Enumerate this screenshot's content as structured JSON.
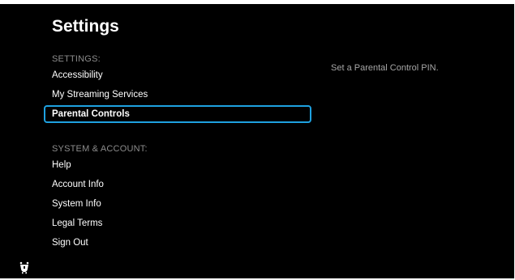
{
  "title": "Settings",
  "sections": [
    {
      "header": "SETTINGS:",
      "items": [
        "Accessibility",
        "My Streaming Services",
        "Parental Controls"
      ]
    },
    {
      "header": "SYSTEM & ACCOUNT:",
      "items": [
        "Help",
        "Account Info",
        "System Info",
        "Legal Terms",
        "Sign Out"
      ]
    }
  ],
  "selected_item": "Parental Controls",
  "description": "Set a Parental Control PIN.",
  "colors": {
    "background": "#000000",
    "focus_border": "#1ea1e0",
    "section_header": "#8c8c8c",
    "description": "#a6a6a6"
  },
  "icons": {
    "logo": "tivo-logo-icon"
  }
}
